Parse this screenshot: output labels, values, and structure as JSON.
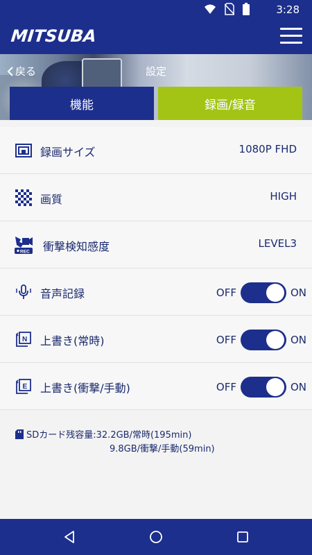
{
  "status_bar": {
    "time": "3:28",
    "icons": [
      "wifi-icon",
      "no-sim-icon",
      "battery-icon"
    ]
  },
  "app_bar": {
    "logo": "MITSUBA",
    "menu_icon": "hamburger-menu-icon"
  },
  "header": {
    "back_label": "戻る",
    "title": "設定"
  },
  "tabs": [
    {
      "label": "機能",
      "active": false
    },
    {
      "label": "録画/録音",
      "active": true
    }
  ],
  "settings": {
    "resolution": {
      "label": "録画サイズ",
      "value": "1080P FHD",
      "icon": "resolution-icon"
    },
    "quality": {
      "label": "画質",
      "value": "HIGH",
      "icon": "quality-icon"
    },
    "shock": {
      "label": "衝撃検知感度",
      "value": "LEVEL3",
      "icon": "shock-rec-icon"
    },
    "audio": {
      "label": "音声記録",
      "off_label": "OFF",
      "on_label": "ON",
      "on": true,
      "icon": "microphone-icon"
    },
    "overwrite_normal": {
      "label": "上書き(常時)",
      "off_label": "OFF",
      "on_label": "ON",
      "on": true,
      "icon": "overwrite-normal-icon"
    },
    "overwrite_event": {
      "label": "上書き(衝撃/手動)",
      "off_label": "OFF",
      "on_label": "ON",
      "on": true,
      "icon": "overwrite-event-icon"
    }
  },
  "sd_card": {
    "line1": "SDカード残容量:32.2GB/常時(195min)",
    "line2": "9.8GB/衝撃/手動(59min)"
  },
  "colors": {
    "primary": "#1d2f8c",
    "accent": "#a3c414",
    "background": "#f3f3f3"
  }
}
